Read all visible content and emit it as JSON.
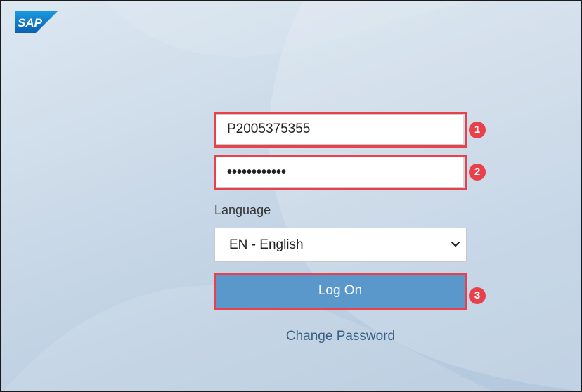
{
  "brand": {
    "logo_text": "SAP"
  },
  "login": {
    "username_value": "P2005375355",
    "password_masked": "••••••••••••",
    "language_label": "Language",
    "language_selected": "EN - English",
    "logon_label": "Log On",
    "change_password_label": "Change Password"
  },
  "annotations": {
    "badge_1": "1",
    "badge_2": "2",
    "badge_3": "3"
  },
  "colors": {
    "highlight": "#e8414b",
    "button": "#5a98cc",
    "link": "#3b5f82"
  }
}
